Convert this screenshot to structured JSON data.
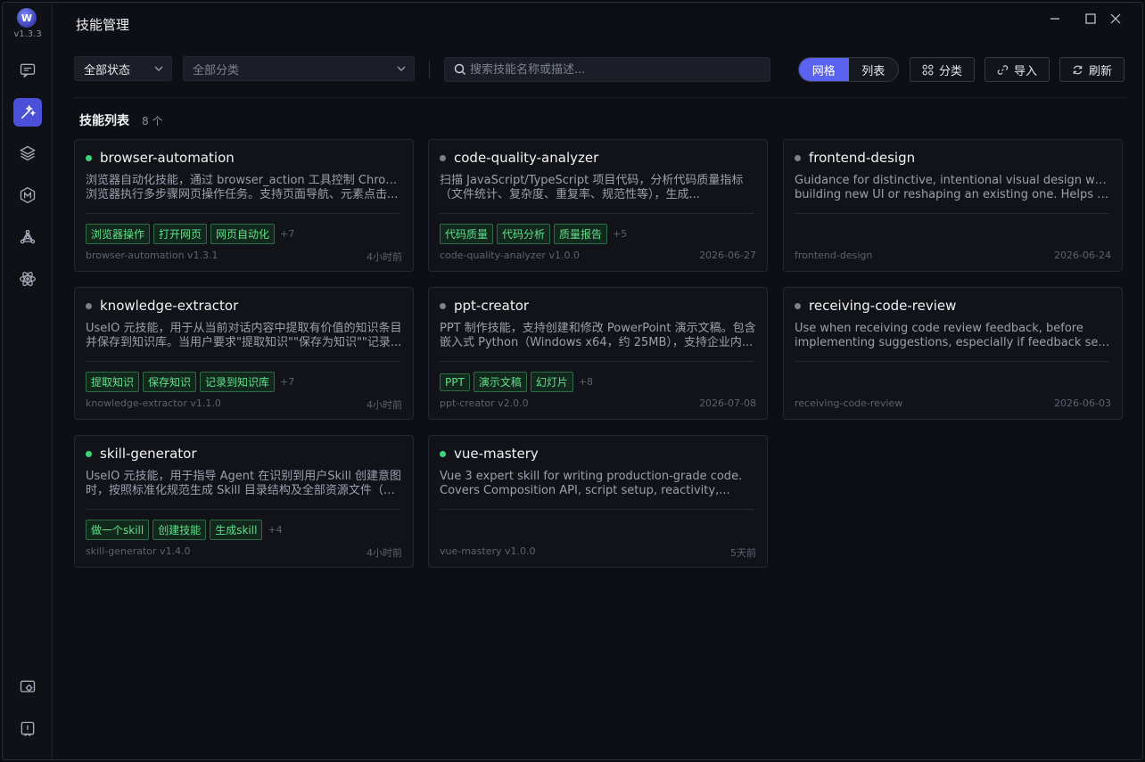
{
  "app": {
    "version": "v1.3.3",
    "logo_letter": "W",
    "title": "技能管理"
  },
  "toolbar": {
    "status_select": "全部状态",
    "category_select": "全部分类",
    "search_placeholder": "搜索技能名称或描述...",
    "view_grid": "网格",
    "view_list": "列表",
    "category_btn": "分类",
    "import_btn": "导入",
    "refresh_btn": "刷新"
  },
  "list": {
    "heading": "技能列表",
    "count": "8 个"
  },
  "colors": {
    "accent": "#5a63f0",
    "active_dot": "#3ed37a",
    "inactive_dot": "#7b808c",
    "tag": "#5ee08a"
  },
  "cards": [
    {
      "name": "browser-automation",
      "active": true,
      "desc1": "浏览器自动化技能，通过 browser_action 工具控制 Chrome",
      "desc2": "浏览器执行多步骤网页操作任务。支持页面导航、元素点击...",
      "tags": [
        "浏览器操作",
        "打开网页",
        "网页自动化"
      ],
      "more": "+7",
      "footer_left": "browser-automation v1.3.1",
      "footer_right": "4小时前"
    },
    {
      "name": "code-quality-analyzer",
      "active": false,
      "desc1": "扫描 JavaScript/TypeScript 项目代码，分析代码质量指标",
      "desc2": "（文件统计、复杂度、重复率、规范性等），生成...",
      "tags": [
        "代码质量",
        "代码分析",
        "质量报告"
      ],
      "more": "+5",
      "footer_left": "code-quality-analyzer v1.0.0",
      "footer_right": "2026-06-27"
    },
    {
      "name": "frontend-design",
      "active": false,
      "desc1": "Guidance for distinctive, intentional visual design when",
      "desc2": "building new UI or reshaping an existing one. Helps wit...",
      "tags": [],
      "more": "",
      "footer_left": "frontend-design",
      "footer_right": "2026-06-24"
    },
    {
      "name": "knowledge-extractor",
      "active": false,
      "desc1": "UseIO 元技能，用于从当前对话内容中提取有价值的知识条目",
      "desc2": "并保存到知识库。当用户要求\"提取知识\"\"保存为知识\"\"记录...",
      "tags": [
        "提取知识",
        "保存知识",
        "记录到知识库"
      ],
      "more": "+7",
      "footer_left": "knowledge-extractor v1.1.0",
      "footer_right": "4小时前"
    },
    {
      "name": "ppt-creator",
      "active": false,
      "desc1": "PPT 制作技能，支持创建和修改 PowerPoint 演示文稿。包含",
      "desc2": "嵌入式 Python（Windows x64，约 25MB），支持企业内...",
      "tags": [
        "PPT",
        "演示文稿",
        "幻灯片"
      ],
      "more": "+8",
      "footer_left": "ppt-creator v2.0.0",
      "footer_right": "2026-07-08"
    },
    {
      "name": "receiving-code-review",
      "active": false,
      "desc1": "Use when receiving code review feedback, before",
      "desc2": "implementing suggestions, especially if feedback seem...",
      "tags": [],
      "more": "",
      "footer_left": "receiving-code-review",
      "footer_right": "2026-06-03"
    },
    {
      "name": "skill-generator",
      "active": true,
      "desc1": "UseIO 元技能，用于指导 Agent 在识别到用户Skill 创建意图",
      "desc2": "时，按照标准化规范生成 Skill 目录结构及全部资源文件（含...",
      "tags": [
        "做一个skill",
        "创建技能",
        "生成skill"
      ],
      "more": "+4",
      "footer_left": "skill-generator v1.4.0",
      "footer_right": "4小时前"
    },
    {
      "name": "vue-mastery",
      "active": true,
      "desc1": "Vue 3 expert skill for writing production-grade code.",
      "desc2": "Covers Composition API, script setup, reactivity,...",
      "tags": [],
      "more": "",
      "footer_left": "vue-mastery v1.0.0",
      "footer_right": "5天前"
    }
  ]
}
